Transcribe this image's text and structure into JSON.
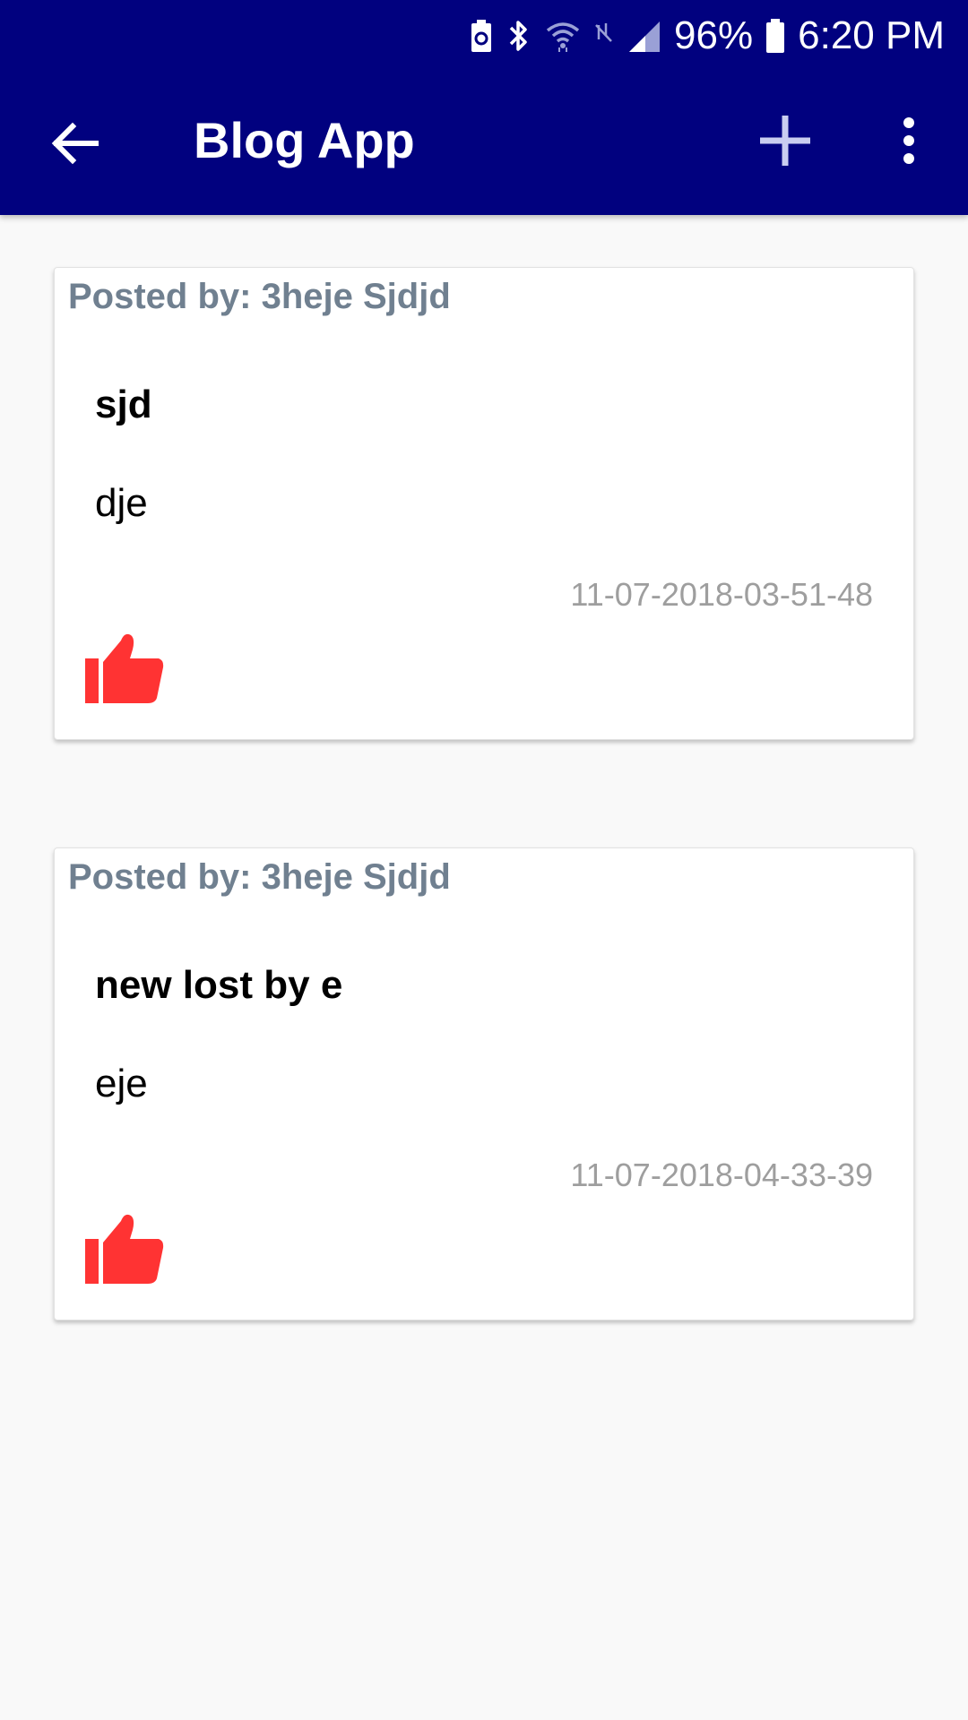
{
  "status_bar": {
    "battery_percent": "96%",
    "time": "6:20 PM",
    "icons": [
      "battery-saver-icon",
      "bluetooth-icon",
      "wifi-icon",
      "no-data-icon",
      "signal-icon",
      "battery-icon"
    ]
  },
  "toolbar": {
    "title": "Blog App",
    "back_icon": "arrow-left-icon",
    "add_icon": "plus-icon",
    "more_icon": "more-vertical-icon",
    "background_color": "#01017f"
  },
  "posts": [
    {
      "posted_by": "Posted by: 3heje Sjdjd",
      "title": "sjd",
      "body": "dje",
      "date": "11-07-2018-03-51-48",
      "like_icon": "thumbs-up-icon",
      "like_color": "#ff3333"
    },
    {
      "posted_by": "Posted by: 3heje Sjdjd",
      "title": "new lost by e",
      "body": "eje",
      "date": "11-07-2018-04-33-39",
      "like_icon": "thumbs-up-icon",
      "like_color": "#ff3333"
    }
  ]
}
